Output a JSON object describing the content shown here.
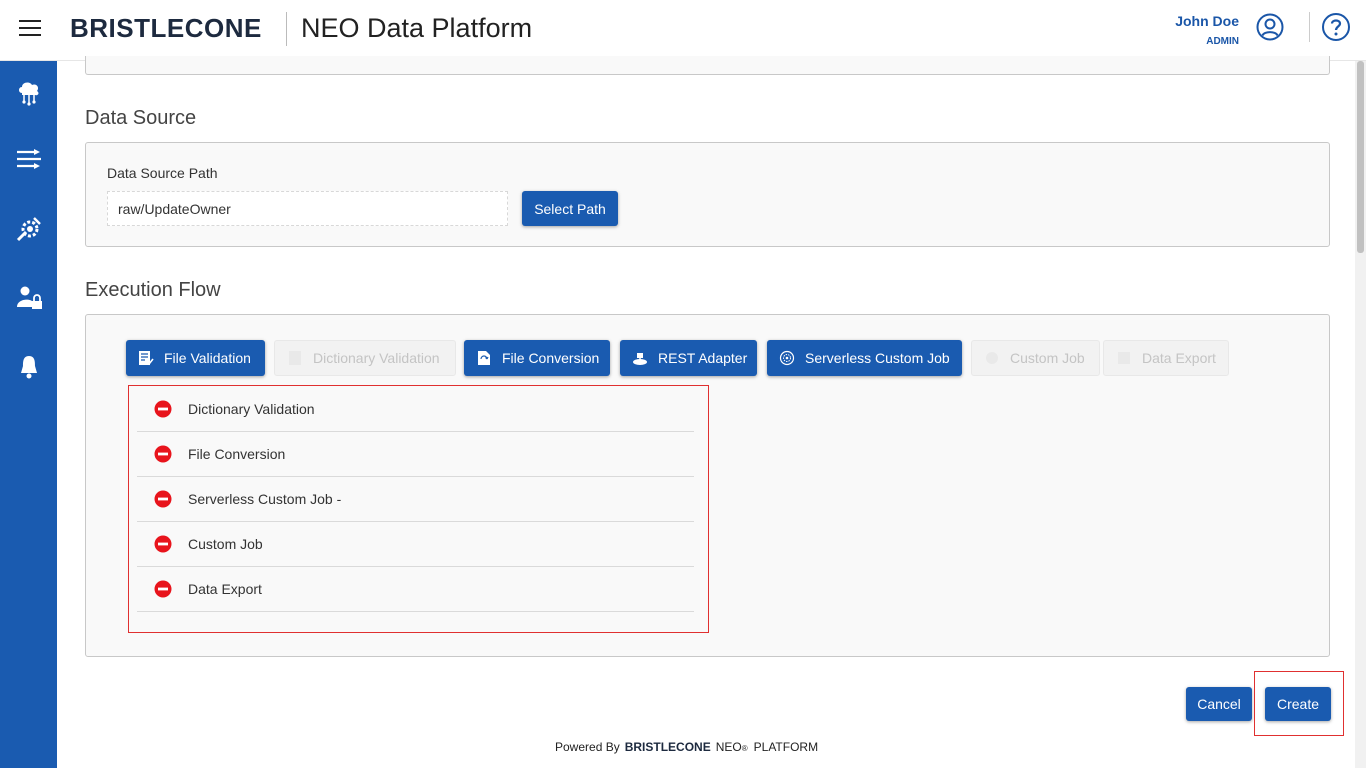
{
  "header": {
    "brand": "BRISTLECONE",
    "app_title": "NEO Data Platform",
    "user_name": "John Doe",
    "user_role": "ADMIN"
  },
  "sidebar": {
    "items": [
      {
        "icon": "cloud-network-icon"
      },
      {
        "icon": "pipeline-icon"
      },
      {
        "icon": "tools-icon"
      },
      {
        "icon": "user-lock-icon"
      },
      {
        "icon": "bell-icon"
      }
    ]
  },
  "data_source": {
    "title": "Data Source",
    "path_label": "Data Source Path",
    "path_value": "raw/UpdateOwner",
    "select_button": "Select Path"
  },
  "execution_flow": {
    "title": "Execution Flow",
    "steps": [
      {
        "label": "File Validation",
        "active": true
      },
      {
        "label": "Dictionary Validation",
        "active": false
      },
      {
        "label": "File Conversion",
        "active": true
      },
      {
        "label": "REST Adapter",
        "active": true
      },
      {
        "label": "Serverless Custom Job",
        "active": true
      },
      {
        "label": "Custom Job",
        "active": false
      },
      {
        "label": "Data Export",
        "active": false
      }
    ],
    "flow_items": [
      "Dictionary Validation",
      "File Conversion",
      "Serverless Custom Job -",
      "Custom Job",
      "Data Export"
    ]
  },
  "actions": {
    "cancel": "Cancel",
    "create": "Create"
  },
  "footer": {
    "powered_by": "Powered By",
    "brand": "BRISTLECONE",
    "neo": "NEO",
    "reg": "®",
    "platform": "PLATFORM"
  },
  "colors": {
    "primary": "#1a5bb0",
    "remove": "#e8141c",
    "highlight": "#e03030"
  }
}
